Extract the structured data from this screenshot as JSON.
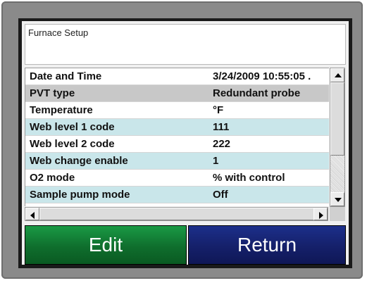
{
  "window": {
    "title": "Furnace Setup"
  },
  "settings": [
    {
      "label": "Date and Time",
      "value": "3/24/2009 10:55:05 ."
    },
    {
      "label": "PVT type",
      "value": "Redundant probe"
    },
    {
      "label": "Temperature",
      "value": "°F"
    },
    {
      "label": "Web level 1 code",
      "value": "111"
    },
    {
      "label": "Web level 2 code",
      "value": "222"
    },
    {
      "label": "Web change enable",
      "value": "1"
    },
    {
      "label": "O2 mode",
      "value": "% with control"
    },
    {
      "label": "Sample pump mode",
      "value": "Off"
    }
  ],
  "buttons": {
    "edit": "Edit",
    "return": "Return"
  },
  "colors": {
    "row_selected": "#c8c8c8",
    "row_alt": "#c9e6ea",
    "edit_button": "#0f6e2d",
    "return_button": "#15206a"
  }
}
